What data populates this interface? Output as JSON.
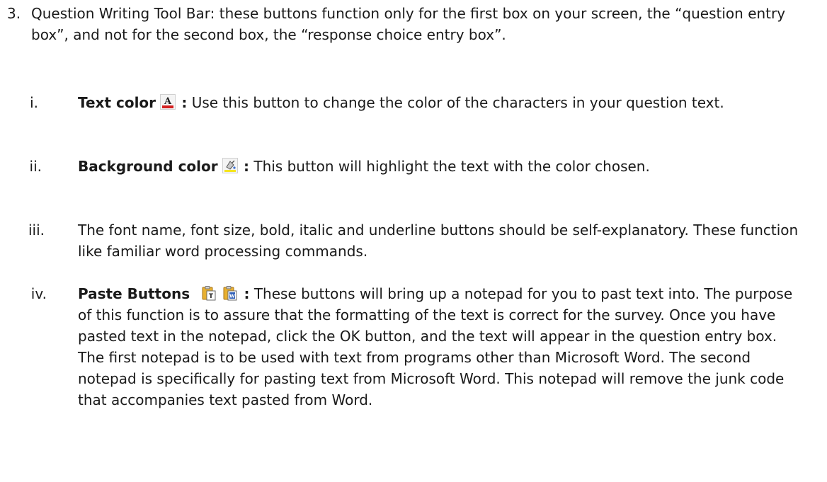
{
  "section": {
    "number": "3.",
    "text": "Question Writing Tool Bar: these buttons function only for the first box on your screen, the “question entry box”, and not for the second box, the “response choice entry box”."
  },
  "items": [
    {
      "numeral": "i.",
      "term": "Text color",
      "icons": [
        "text-color-icon"
      ],
      "colon": ":",
      "description": "Use this button to change the color of the characters in your question text."
    },
    {
      "numeral": "ii.",
      "term": "Background color",
      "icons": [
        "background-color-icon"
      ],
      "colon": ":",
      "description": "This button will highlight the text with the color chosen."
    },
    {
      "numeral": "iii.",
      "description": "The font name, font size, bold, italic and underline buttons should be self-explanatory. These function like familiar word processing commands."
    },
    {
      "numeral": "iv.",
      "term": "Paste Buttons",
      "icons": [
        "paste-text-icon",
        "paste-from-word-icon"
      ],
      "colon": ":",
      "description": "These buttons will bring up a notepad for you to past text into. The purpose of this function is to assure that the formatting of the text is correct for the survey. Once you have pasted text in the notepad, click the OK button, and the text will appear in the question entry box. The first notepad is to be used with text from programs other than Microsoft Word. The second notepad is specifically for pasting text from Microsoft Word. This notepad will remove the junk code that accompanies text pasted from Word."
    }
  ],
  "colors": {
    "text": "#1a1a1a",
    "text_color_icon_underline": "#d42020",
    "paste_icon_folder": "#e8b030"
  }
}
